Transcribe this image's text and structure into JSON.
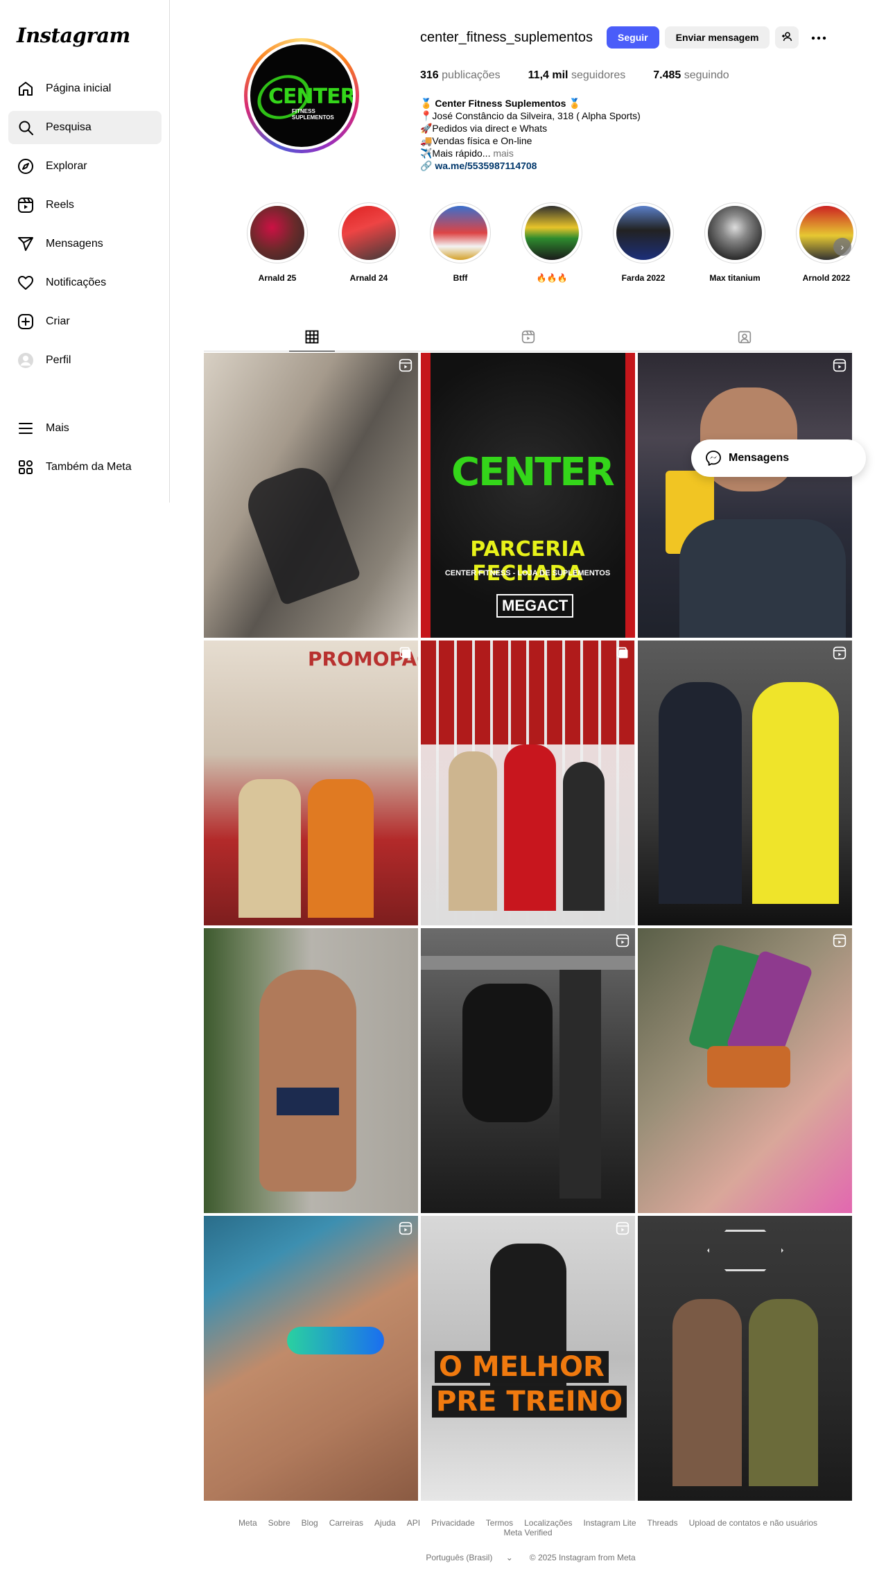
{
  "app": {
    "logo": "Instagram"
  },
  "sidebar": {
    "items": [
      {
        "label": "Página inicial",
        "icon": "home-icon"
      },
      {
        "label": "Pesquisa",
        "icon": "search-icon",
        "active": true
      },
      {
        "label": "Explorar",
        "icon": "explore-icon"
      },
      {
        "label": "Reels",
        "icon": "reels-icon"
      },
      {
        "label": "Mensagens",
        "icon": "messages-icon"
      },
      {
        "label": "Notificações",
        "icon": "heart-icon"
      },
      {
        "label": "Criar",
        "icon": "create-icon"
      },
      {
        "label": "Perfil",
        "icon": "profile-icon"
      }
    ],
    "bottom": [
      {
        "label": "Mais",
        "icon": "menu-icon"
      },
      {
        "label": "Também da Meta",
        "icon": "meta-apps-icon"
      }
    ]
  },
  "profile": {
    "username": "center_fitness_suplementos",
    "follow_label": "Seguir",
    "message_label": "Enviar mensagem",
    "avatar_brand": "CENTER",
    "avatar_sub": "FITNESS\nSUPLEMENTOS",
    "stats": {
      "posts_count": "316",
      "posts_label": "publicações",
      "followers_count": "11,4 mil",
      "followers_label": "seguidores",
      "following_count": "7.485",
      "following_label": "seguindo"
    },
    "bio": {
      "name": "🏅 Center Fitness Suplementos 🏅",
      "line1": "📍José Constâncio da Silveira, 318 ( Alpha Sports)",
      "line2": "🚀Pedidos via direct e Whats",
      "line3": "🚚Vendas física e On-line",
      "line4": "✈️Mais rápido...",
      "more": "mais",
      "link": "wa.me/5535987114708"
    }
  },
  "highlights": [
    {
      "label": "Arnald 25"
    },
    {
      "label": "Arnald 24"
    },
    {
      "label": "Btff"
    },
    {
      "label": "🔥🔥🔥"
    },
    {
      "label": "Farda 2022"
    },
    {
      "label": "Max titanium"
    },
    {
      "label": "Arnold 2022"
    }
  ],
  "posts": [
    {
      "overlay": ""
    },
    {
      "overlay_title": "PARCERIA FECHADA",
      "overlay_sub": "CENTER FITNESS - LOJA DE SUPLEMENTOS",
      "overlay_logo": "MEGACT"
    },
    {
      "overlay": ""
    },
    {
      "overlay_text": "PROMOPAC"
    },
    {
      "overlay": ""
    },
    {
      "overlay": ""
    },
    {
      "overlay": ""
    },
    {
      "overlay": ""
    },
    {
      "overlay": ""
    },
    {
      "overlay": ""
    },
    {
      "overlay_line1": "O MELHOR",
      "overlay_line2": "PRE TREINO"
    },
    {
      "overlay": ""
    }
  ],
  "floating": {
    "messages_label": "Mensagens"
  },
  "footer": {
    "links": [
      "Meta",
      "Sobre",
      "Blog",
      "Carreiras",
      "Ajuda",
      "API",
      "Privacidade",
      "Termos",
      "Localizações",
      "Instagram Lite",
      "Threads",
      "Upload de contatos e não usuários",
      "Meta Verified"
    ],
    "language": "Português (Brasil)",
    "copyright": "© 2025 Instagram from Meta"
  }
}
